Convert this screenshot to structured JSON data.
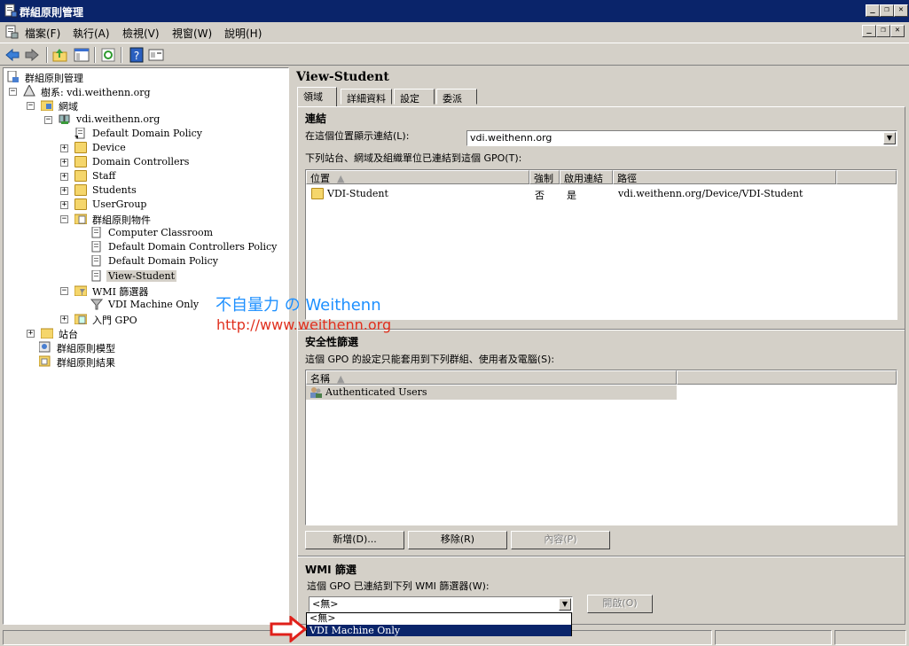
{
  "window": {
    "title": "群組原則管理"
  },
  "menu": {
    "items": [
      "檔案(F)",
      "執行(A)",
      "檢視(V)",
      "視窗(W)",
      "說明(H)"
    ]
  },
  "tree": {
    "root": "群組原則管理",
    "forest": "樹系: vdi.weithenn.org",
    "domains": "網域",
    "domain": "vdi.weithenn.org",
    "children": [
      "Default Domain Policy",
      "Device",
      "Domain Controllers",
      "Staff",
      "Students",
      "UserGroup",
      "群組原則物件"
    ],
    "gpo_objects": [
      "Computer Classroom",
      "Default Domain Controllers Policy",
      "Default Domain Policy",
      "View-Student"
    ],
    "wmi_filters": "WMI 篩選器",
    "wmi_children": [
      "VDI Machine Only"
    ],
    "starter_gpo": "入門 GPO",
    "sites": "站台",
    "modeling": "群組原則模型",
    "results": "群組原則結果"
  },
  "right": {
    "title": "View-Student",
    "tabs": [
      "領域",
      "詳細資料",
      "設定",
      "委派"
    ],
    "links": {
      "title": "連結",
      "location_label": "在這個位置顯示連結(L):",
      "location_value": "vdi.weithenn.org",
      "list_label": "下列站台、網域及組織單位已連結到這個 GPO(T):",
      "columns": [
        "位置",
        "強制",
        "啟用連結",
        "路徑"
      ],
      "rows": [
        {
          "location": "VDI-Student",
          "enforced": "否",
          "enabled": "是",
          "path": "vdi.weithenn.org/Device/VDI-Student"
        }
      ]
    },
    "security": {
      "title": "安全性篩選",
      "description": "這個 GPO 的設定只能套用到下列群組、使用者及電腦(S):",
      "columns": [
        "名稱"
      ],
      "rows": [
        "Authenticated Users"
      ],
      "add": "新增(D)...",
      "remove": "移除(R)",
      "properties": "內容(P)"
    },
    "wmi": {
      "title": "WMI 篩選",
      "description": "這個 GPO 已連結到下列 WMI 篩選器(W):",
      "selected": "<無>",
      "open": "開啟(O)",
      "options": [
        "<無>",
        "VDI Machine Only"
      ]
    }
  },
  "watermark": {
    "line1": "不自量力 の Weithenn",
    "line2": "http://www.weithenn.org"
  },
  "colors": {
    "selection": "#0a246a",
    "watermark_blue": "#1e90ff",
    "watermark_red": "#e0301e",
    "arrow_red": "#e0201a"
  }
}
